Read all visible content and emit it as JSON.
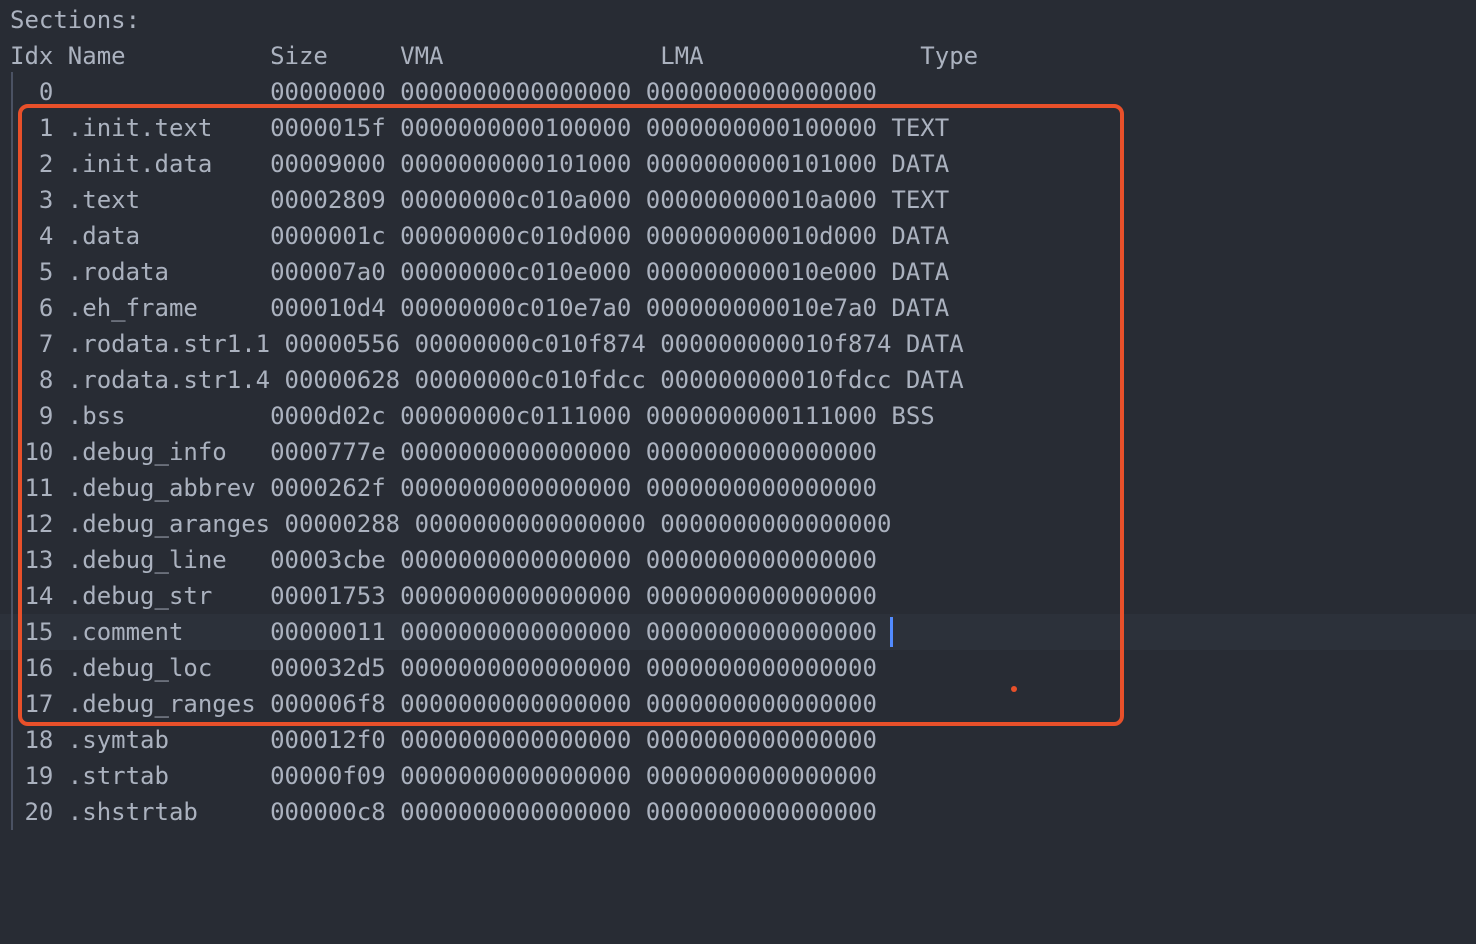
{
  "terminal": {
    "heading": "Sections:",
    "header_line": "Idx Name          Size     VMA               LMA               Type",
    "rows": [
      "  0               00000000 0000000000000000 0000000000000000",
      "  1 .init.text    0000015f 0000000000100000 0000000000100000 TEXT",
      "  2 .init.data    00009000 0000000000101000 0000000000101000 DATA",
      "  3 .text         00002809 00000000c010a000 000000000010a000 TEXT",
      "  4 .data         0000001c 00000000c010d000 000000000010d000 DATA",
      "  5 .rodata       000007a0 00000000c010e000 000000000010e000 DATA",
      "  6 .eh_frame     000010d4 00000000c010e7a0 000000000010e7a0 DATA",
      "  7 .rodata.str1.1 00000556 00000000c010f874 000000000010f874 DATA",
      "  8 .rodata.str1.4 00000628 00000000c010fdcc 000000000010fdcc DATA",
      "  9 .bss          0000d02c 00000000c0111000 0000000000111000 BSS",
      " 10 .debug_info   0000777e 0000000000000000 0000000000000000",
      " 11 .debug_abbrev 0000262f 0000000000000000 0000000000000000",
      " 12 .debug_aranges 00000288 0000000000000000 0000000000000000",
      " 13 .debug_line   00003cbe 0000000000000000 0000000000000000",
      " 14 .debug_str    00001753 0000000000000000 0000000000000000",
      " 15 .comment      00000011 0000000000000000 0000000000000000",
      " 16 .debug_loc    000032d5 0000000000000000 0000000000000000",
      " 17 .debug_ranges 000006f8 0000000000000000 0000000000000000",
      " 18 .symtab       000012f0 0000000000000000 0000000000000000",
      " 19 .strtab       00000f09 0000000000000000 0000000000000000",
      " 20 .shstrtab     000000c8 0000000000000000 0000000000000000"
    ]
  },
  "colors": {
    "background": "#282c34",
    "text": "#abb2bf",
    "annotation": "#e8502a",
    "cursor": "#528bff"
  }
}
